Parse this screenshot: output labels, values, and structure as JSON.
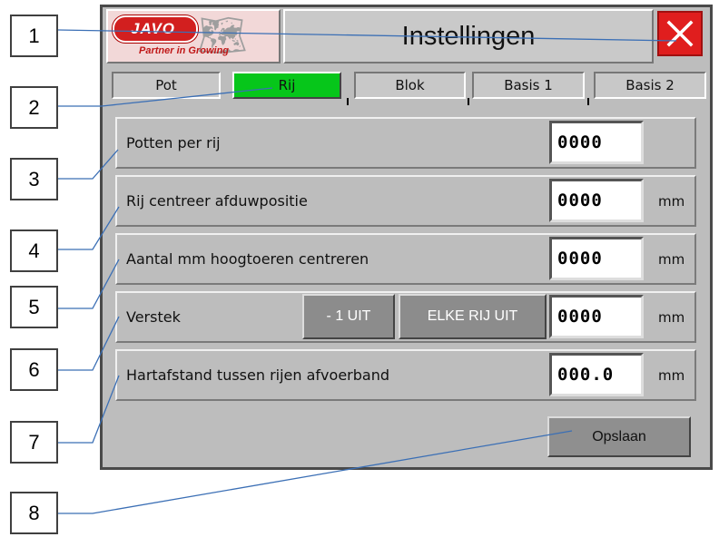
{
  "callouts": [
    "1",
    "2",
    "3",
    "4",
    "5",
    "6",
    "7",
    "8"
  ],
  "header": {
    "logo": {
      "brand": "JAVO",
      "tagline": "Partner in Growing"
    },
    "title": "Instellingen",
    "close_icon": "close-icon"
  },
  "tabs": [
    {
      "label": "Pot",
      "active": false
    },
    {
      "label": "Rij",
      "active": true
    },
    {
      "label": "Blok",
      "active": false
    },
    {
      "label": "Basis 1",
      "active": false
    },
    {
      "label": "Basis 2",
      "active": false
    }
  ],
  "settings": [
    {
      "label": "Potten per rij",
      "value": "0000",
      "unit": ""
    },
    {
      "label": "Rij centreer afduwpositie",
      "value": "0000",
      "unit": "mm"
    },
    {
      "label": "Aantal mm hoogtoeren centreren",
      "value": "0000",
      "unit": "mm"
    },
    {
      "label": "Verstek",
      "value": "0000",
      "unit": "mm",
      "buttons": [
        "- 1 UIT",
        "ELKE RIJ UIT"
      ]
    },
    {
      "label": "Hartafstand tussen rijen afvoerband",
      "value": "000.0",
      "unit": "mm"
    }
  ],
  "save_label": "Opslaan",
  "colors": {
    "panel_bg": "#bdbdbd",
    "active_tab": "#06c61a",
    "close_button": "#e01e1e",
    "brand_red": "#d21f1f"
  }
}
